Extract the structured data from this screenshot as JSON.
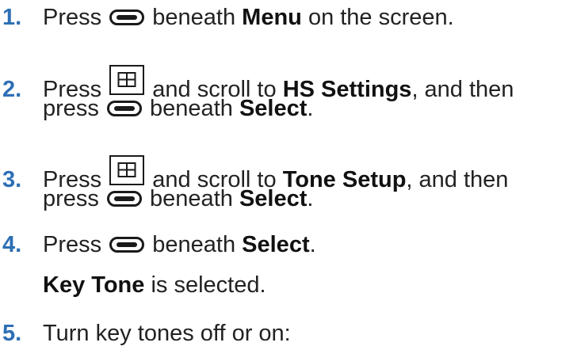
{
  "icons": {
    "softkey": "softkey-button-icon",
    "phonebook": "phonebook-button-icon"
  },
  "colors": {
    "step_number": "#2e6fb6",
    "text": "#222222"
  },
  "steps": [
    {
      "number": "1.",
      "line1": {
        "t1": "Press",
        "t2": "beneath",
        "b1": "Menu",
        "t3": "on the screen."
      }
    },
    {
      "number": "2.",
      "line1": {
        "t1": "Press",
        "t2": "and scroll to",
        "b1": "HS Settings",
        "t3": ", and then"
      },
      "line2": {
        "t1": "press",
        "t2": "beneath",
        "b1": "Select",
        "t3": "."
      }
    },
    {
      "number": "3.",
      "line1": {
        "t1": "Press",
        "t2": "and scroll to",
        "b1": "Tone Setup",
        "t3": ", and then"
      },
      "line2": {
        "t1": "press",
        "t2": "beneath",
        "b1": "Select",
        "t3": "."
      }
    },
    {
      "number": "4.",
      "line1": {
        "t1": "Press",
        "t2": "beneath",
        "b1": "Select",
        "t3": "."
      },
      "result": {
        "b1": "Key Tone",
        "t1": "is selected."
      }
    },
    {
      "number": "5.",
      "line1": {
        "t1": "Turn key tones off or on:"
      }
    }
  ]
}
